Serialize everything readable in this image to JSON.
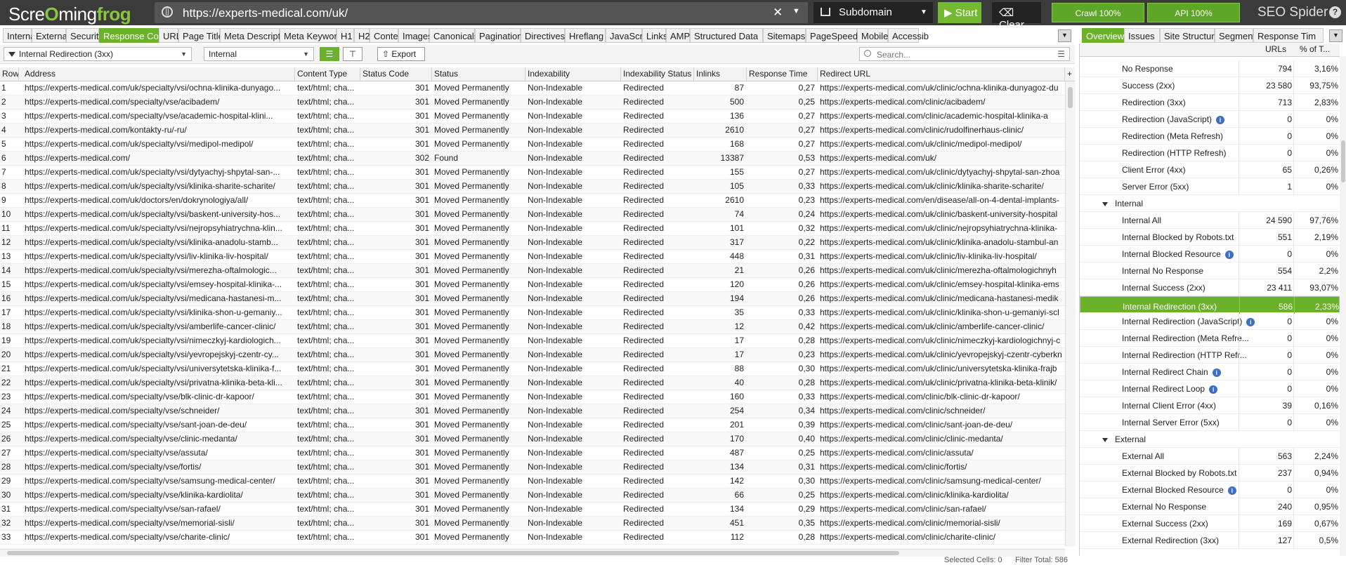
{
  "app": {
    "logo_prefix": "Scre",
    "logo_mid": "ming",
    "logo_suffix": "frog",
    "brand_a": "SEO",
    "brand_b": " Spider",
    "url": "https://experts-medical.com/uk/",
    "mode": "Subdomain",
    "start_label": "Start",
    "clear_label": "Clear",
    "crawl_label": "Crawl 100%",
    "api_label": "API 100%",
    "crawl_progress": 1.0,
    "api_progress": 1.0,
    "help_glyph": "?",
    "accent": "#6bb12a"
  },
  "tabs": [
    "Internal",
    "External",
    "Security",
    "Response Codes",
    "URL",
    "Page Titles",
    "Meta Description",
    "Meta Keywords",
    "H1",
    "H2",
    "Content",
    "Images",
    "Canonicals",
    "Pagination",
    "Directives",
    "Hreflang",
    "JavaScript",
    "Links",
    "AMP",
    "Structured Data",
    "Sitemaps",
    "PageSpeed",
    "Mobile",
    "Accessib"
  ],
  "active_tab": "Response Codes",
  "right_tabs": [
    "Overview",
    "Issues",
    "Site Structure",
    "Segments",
    "Response Tim"
  ],
  "active_right_tab": "Overview",
  "filter": {
    "filter_value": "Internal Redirection (3xx)",
    "scope_value": "Internal",
    "export_label": "Export",
    "search_placeholder": "Search..."
  },
  "table": {
    "columns": [
      "Row",
      "Address",
      "Content Type",
      "Status Code",
      "Status",
      "Indexability",
      "Indexability Status",
      "Inlinks",
      "Response Time",
      "Redirect URL"
    ],
    "rows": [
      [
        "1",
        "https://experts-medical.com/uk/specialty/vsi/ochna-klinika-dunyago...",
        "text/html; cha...",
        "301",
        "Moved Permanently",
        "Non-Indexable",
        "Redirected",
        "87",
        "0,27",
        "https://experts-medical.com/uk/clinic/ochna-klinika-dunyagoz-du"
      ],
      [
        "2",
        "https://experts-medical.com/specialty/vse/acibadem/",
        "text/html; cha...",
        "301",
        "Moved Permanently",
        "Non-Indexable",
        "Redirected",
        "500",
        "0,25",
        "https://experts-medical.com/clinic/acibadem/"
      ],
      [
        "3",
        "https://experts-medical.com/specialty/vse/academic-hospital-klini...",
        "text/html; cha...",
        "301",
        "Moved Permanently",
        "Non-Indexable",
        "Redirected",
        "136",
        "0,27",
        "https://experts-medical.com/clinic/academic-hospital-klinika-a"
      ],
      [
        "4",
        "https://experts-medical.com/kontakty-ru/-ru/",
        "text/html; cha...",
        "301",
        "Moved Permanently",
        "Non-Indexable",
        "Redirected",
        "2610",
        "0,27",
        "https://experts-medical.com/clinic/rudolfinerhaus-clinic/"
      ],
      [
        "5",
        "https://experts-medical.com/uk/specialty/vsi/medipol-medipol/",
        "text/html; cha...",
        "301",
        "Moved Permanently",
        "Non-Indexable",
        "Redirected",
        "168",
        "0,27",
        "https://experts-medical.com/uk/clinic/medipol-medipol/"
      ],
      [
        "6",
        "https://experts-medical.com/",
        "text/html; cha...",
        "302",
        "Found",
        "Non-Indexable",
        "Redirected",
        "13387",
        "0,53",
        "https://experts-medical.com/uk/"
      ],
      [
        "7",
        "https://experts-medical.com/uk/specialty/vsi/dytyachyj-shpytal-san-...",
        "text/html; cha...",
        "301",
        "Moved Permanently",
        "Non-Indexable",
        "Redirected",
        "155",
        "0,27",
        "https://experts-medical.com/uk/clinic/dytyachyj-shpytal-san-zhoa"
      ],
      [
        "8",
        "https://experts-medical.com/uk/specialty/vsi/klinika-sharite-scharite/",
        "text/html; cha...",
        "301",
        "Moved Permanently",
        "Non-Indexable",
        "Redirected",
        "105",
        "0,33",
        "https://experts-medical.com/uk/clinic/klinika-sharite-scharite/"
      ],
      [
        "9",
        "https://experts-medical.com/uk/doctors/en/dokrynologiya/all/",
        "text/html; cha...",
        "301",
        "Moved Permanently",
        "Non-Indexable",
        "Redirected",
        "2610",
        "0,23",
        "https://experts-medical.com/en/disease/all-on-4-dental-implants-"
      ],
      [
        "10",
        "https://experts-medical.com/uk/specialty/vsi/baskent-university-hos...",
        "text/html; cha...",
        "301",
        "Moved Permanently",
        "Non-Indexable",
        "Redirected",
        "74",
        "0,24",
        "https://experts-medical.com/uk/clinic/baskent-university-hospital"
      ],
      [
        "11",
        "https://experts-medical.com/uk/specialty/vsi/nejropsyhiatrychna-klin...",
        "text/html; cha...",
        "301",
        "Moved Permanently",
        "Non-Indexable",
        "Redirected",
        "101",
        "0,32",
        "https://experts-medical.com/uk/clinic/nejropsyhiatrychna-klinika-"
      ],
      [
        "12",
        "https://experts-medical.com/uk/specialty/vsi/klinika-anadolu-stamb...",
        "text/html; cha...",
        "301",
        "Moved Permanently",
        "Non-Indexable",
        "Redirected",
        "317",
        "0,22",
        "https://experts-medical.com/uk/clinic/klinika-anadolu-stambul-an"
      ],
      [
        "13",
        "https://experts-medical.com/uk/specialty/vsi/liv-klinika-liv-hospital/",
        "text/html; cha...",
        "301",
        "Moved Permanently",
        "Non-Indexable",
        "Redirected",
        "448",
        "0,31",
        "https://experts-medical.com/uk/clinic/liv-klinika-liv-hospital/"
      ],
      [
        "14",
        "https://experts-medical.com/uk/specialty/vsi/merezha-oftalmologic...",
        "text/html; cha...",
        "301",
        "Moved Permanently",
        "Non-Indexable",
        "Redirected",
        "21",
        "0,26",
        "https://experts-medical.com/uk/clinic/merezha-oftalmologichnyh"
      ],
      [
        "15",
        "https://experts-medical.com/uk/specialty/vsi/emsey-hospital-klinika-...",
        "text/html; cha...",
        "301",
        "Moved Permanently",
        "Non-Indexable",
        "Redirected",
        "120",
        "0,26",
        "https://experts-medical.com/uk/clinic/emsey-hospital-klinika-ems"
      ],
      [
        "16",
        "https://experts-medical.com/uk/specialty/vsi/medicana-hastanesi-m...",
        "text/html; cha...",
        "301",
        "Moved Permanently",
        "Non-Indexable",
        "Redirected",
        "194",
        "0,26",
        "https://experts-medical.com/uk/clinic/medicana-hastanesi-medik"
      ],
      [
        "17",
        "https://experts-medical.com/uk/specialty/vsi/klinika-shon-u-gemaniy...",
        "text/html; cha...",
        "301",
        "Moved Permanently",
        "Non-Indexable",
        "Redirected",
        "35",
        "0,33",
        "https://experts-medical.com/uk/clinic/klinika-shon-u-gemaniyi-scl"
      ],
      [
        "18",
        "https://experts-medical.com/uk/specialty/vsi/amberlife-cancer-clinic/",
        "text/html; cha...",
        "301",
        "Moved Permanently",
        "Non-Indexable",
        "Redirected",
        "12",
        "0,42",
        "https://experts-medical.com/uk/clinic/amberlife-cancer-clinic/"
      ],
      [
        "19",
        "https://experts-medical.com/uk/specialty/vsi/nimeczkyj-kardiologich...",
        "text/html; cha...",
        "301",
        "Moved Permanently",
        "Non-Indexable",
        "Redirected",
        "17",
        "0,28",
        "https://experts-medical.com/uk/clinic/nimeczkyj-kardiologichnyj-c"
      ],
      [
        "20",
        "https://experts-medical.com/uk/specialty/vsi/yevropejskyj-czentr-cy...",
        "text/html; cha...",
        "301",
        "Moved Permanently",
        "Non-Indexable",
        "Redirected",
        "17",
        "0,23",
        "https://experts-medical.com/uk/clinic/yevropejskyj-czentr-cyberkn"
      ],
      [
        "21",
        "https://experts-medical.com/uk/specialty/vsi/universytetska-klinika-f...",
        "text/html; cha...",
        "301",
        "Moved Permanently",
        "Non-Indexable",
        "Redirected",
        "88",
        "0,30",
        "https://experts-medical.com/uk/clinic/universytetska-klinika-frajb"
      ],
      [
        "22",
        "https://experts-medical.com/uk/specialty/vsi/privatna-klinika-beta-kli...",
        "text/html; cha...",
        "301",
        "Moved Permanently",
        "Non-Indexable",
        "Redirected",
        "40",
        "0,28",
        "https://experts-medical.com/uk/clinic/privatna-klinika-beta-klinik/"
      ],
      [
        "23",
        "https://experts-medical.com/specialty/vse/blk-clinic-dr-kapoor/",
        "text/html; cha...",
        "301",
        "Moved Permanently",
        "Non-Indexable",
        "Redirected",
        "160",
        "0,33",
        "https://experts-medical.com/clinic/blk-clinic-dr-kapoor/"
      ],
      [
        "24",
        "https://experts-medical.com/specialty/vse/schneider/",
        "text/html; cha...",
        "301",
        "Moved Permanently",
        "Non-Indexable",
        "Redirected",
        "254",
        "0,34",
        "https://experts-medical.com/clinic/schneider/"
      ],
      [
        "25",
        "https://experts-medical.com/specialty/vse/sant-joan-de-deu/",
        "text/html; cha...",
        "301",
        "Moved Permanently",
        "Non-Indexable",
        "Redirected",
        "201",
        "0,39",
        "https://experts-medical.com/clinic/sant-joan-de-deu/"
      ],
      [
        "26",
        "https://experts-medical.com/specialty/vse/clinic-medanta/",
        "text/html; cha...",
        "301",
        "Moved Permanently",
        "Non-Indexable",
        "Redirected",
        "170",
        "0,40",
        "https://experts-medical.com/clinic/clinic-medanta/"
      ],
      [
        "27",
        "https://experts-medical.com/specialty/vse/assuta/",
        "text/html; cha...",
        "301",
        "Moved Permanently",
        "Non-Indexable",
        "Redirected",
        "487",
        "0,25",
        "https://experts-medical.com/clinic/assuta/"
      ],
      [
        "28",
        "https://experts-medical.com/specialty/vse/fortis/",
        "text/html; cha...",
        "301",
        "Moved Permanently",
        "Non-Indexable",
        "Redirected",
        "134",
        "0,31",
        "https://experts-medical.com/clinic/fortis/"
      ],
      [
        "29",
        "https://experts-medical.com/specialty/vse/samsung-medical-center/",
        "text/html; cha...",
        "301",
        "Moved Permanently",
        "Non-Indexable",
        "Redirected",
        "142",
        "0,30",
        "https://experts-medical.com/clinic/samsung-medical-center/"
      ],
      [
        "30",
        "https://experts-medical.com/specialty/vse/klinika-kardiolita/",
        "text/html; cha...",
        "301",
        "Moved Permanently",
        "Non-Indexable",
        "Redirected",
        "66",
        "0,25",
        "https://experts-medical.com/clinic/klinika-kardiolita/"
      ],
      [
        "31",
        "https://experts-medical.com/specialty/vse/san-rafael/",
        "text/html; cha...",
        "301",
        "Moved Permanently",
        "Non-Indexable",
        "Redirected",
        "134",
        "0,29",
        "https://experts-medical.com/clinic/san-rafael/"
      ],
      [
        "32",
        "https://experts-medical.com/specialty/vse/memorial-sisli/",
        "text/html; cha...",
        "301",
        "Moved Permanently",
        "Non-Indexable",
        "Redirected",
        "451",
        "0,35",
        "https://experts-medical.com/clinic/memorial-sisli/"
      ],
      [
        "33",
        "https://experts-medical.com/specialty/vse/charite-clinic/",
        "text/html; cha...",
        "301",
        "Moved Permanently",
        "Non-Indexable",
        "Redirected",
        "112",
        "0,28",
        "https://experts-medical.com/clinic/charite-clinic/"
      ]
    ]
  },
  "overview": {
    "columns": [
      "URLs",
      "% of T..."
    ],
    "items": [
      {
        "label": "No Response",
        "urls": "794",
        "pct": "3,16%",
        "indent": 2,
        "info": false,
        "section": false,
        "selected": false
      },
      {
        "label": "Success (2xx)",
        "urls": "23 580",
        "pct": "93,75%",
        "indent": 2,
        "info": false,
        "section": false,
        "selected": false
      },
      {
        "label": "Redirection (3xx)",
        "urls": "713",
        "pct": "2,83%",
        "indent": 2,
        "info": false,
        "section": false,
        "selected": false
      },
      {
        "label": "Redirection (JavaScript)",
        "urls": "0",
        "pct": "0%",
        "indent": 2,
        "info": true,
        "section": false,
        "selected": false
      },
      {
        "label": "Redirection (Meta Refresh)",
        "urls": "0",
        "pct": "0%",
        "indent": 2,
        "info": false,
        "section": false,
        "selected": false
      },
      {
        "label": "Redirection (HTTP Refresh)",
        "urls": "0",
        "pct": "0%",
        "indent": 2,
        "info": false,
        "section": false,
        "selected": false
      },
      {
        "label": "Client Error (4xx)",
        "urls": "65",
        "pct": "0,26%",
        "indent": 2,
        "info": false,
        "section": false,
        "selected": false
      },
      {
        "label": "Server Error (5xx)",
        "urls": "1",
        "pct": "0%",
        "indent": 2,
        "info": false,
        "section": false,
        "selected": false
      },
      {
        "label": "Internal",
        "urls": "",
        "pct": "",
        "indent": 1,
        "info": false,
        "section": true,
        "selected": false
      },
      {
        "label": "Internal All",
        "urls": "24 590",
        "pct": "97,76%",
        "indent": 2,
        "info": false,
        "section": false,
        "selected": false
      },
      {
        "label": "Internal Blocked by Robots.txt",
        "urls": "551",
        "pct": "2,19%",
        "indent": 2,
        "info": false,
        "section": false,
        "selected": false
      },
      {
        "label": "Internal Blocked Resource",
        "urls": "0",
        "pct": "0%",
        "indent": 2,
        "info": true,
        "section": false,
        "selected": false
      },
      {
        "label": "Internal No Response",
        "urls": "554",
        "pct": "2,2%",
        "indent": 2,
        "info": false,
        "section": false,
        "selected": false
      },
      {
        "label": "Internal Success (2xx)",
        "urls": "23 411",
        "pct": "93,07%",
        "indent": 2,
        "info": false,
        "section": false,
        "selected": false
      },
      {
        "label": "Internal Redirection (3xx)",
        "urls": "586",
        "pct": "2,33%",
        "indent": 2,
        "info": false,
        "section": false,
        "selected": true
      },
      {
        "label": "Internal Redirection (JavaScript)",
        "urls": "0",
        "pct": "0%",
        "indent": 2,
        "info": true,
        "section": false,
        "selected": false
      },
      {
        "label": "Internal Redirection (Meta Refre...",
        "urls": "0",
        "pct": "0%",
        "indent": 2,
        "info": false,
        "section": false,
        "selected": false
      },
      {
        "label": "Internal Redirection (HTTP Refr...",
        "urls": "0",
        "pct": "0%",
        "indent": 2,
        "info": false,
        "section": false,
        "selected": false
      },
      {
        "label": "Internal Redirect Chain",
        "urls": "0",
        "pct": "0%",
        "indent": 2,
        "info": true,
        "section": false,
        "selected": false
      },
      {
        "label": "Internal Redirect Loop",
        "urls": "0",
        "pct": "0%",
        "indent": 2,
        "info": true,
        "section": false,
        "selected": false
      },
      {
        "label": "Internal Client Error (4xx)",
        "urls": "39",
        "pct": "0,16%",
        "indent": 2,
        "info": false,
        "section": false,
        "selected": false
      },
      {
        "label": "Internal Server Error (5xx)",
        "urls": "0",
        "pct": "0%",
        "indent": 2,
        "info": false,
        "section": false,
        "selected": false
      },
      {
        "label": "External",
        "urls": "",
        "pct": "",
        "indent": 1,
        "info": false,
        "section": true,
        "selected": false
      },
      {
        "label": "External All",
        "urls": "563",
        "pct": "2,24%",
        "indent": 2,
        "info": false,
        "section": false,
        "selected": false
      },
      {
        "label": "External Blocked by Robots.txt",
        "urls": "237",
        "pct": "0,94%",
        "indent": 2,
        "info": false,
        "section": false,
        "selected": false
      },
      {
        "label": "External Blocked Resource",
        "urls": "0",
        "pct": "0%",
        "indent": 2,
        "info": true,
        "section": false,
        "selected": false
      },
      {
        "label": "External No Response",
        "urls": "240",
        "pct": "0,95%",
        "indent": 2,
        "info": false,
        "section": false,
        "selected": false
      },
      {
        "label": "External Success (2xx)",
        "urls": "169",
        "pct": "0,67%",
        "indent": 2,
        "info": false,
        "section": false,
        "selected": false
      },
      {
        "label": "External Redirection (3xx)",
        "urls": "127",
        "pct": "0,5%",
        "indent": 2,
        "info": false,
        "section": false,
        "selected": false
      }
    ]
  },
  "status": {
    "selected_cells": "Selected Cells:  0",
    "filter_total": "Filter Total:  586"
  }
}
